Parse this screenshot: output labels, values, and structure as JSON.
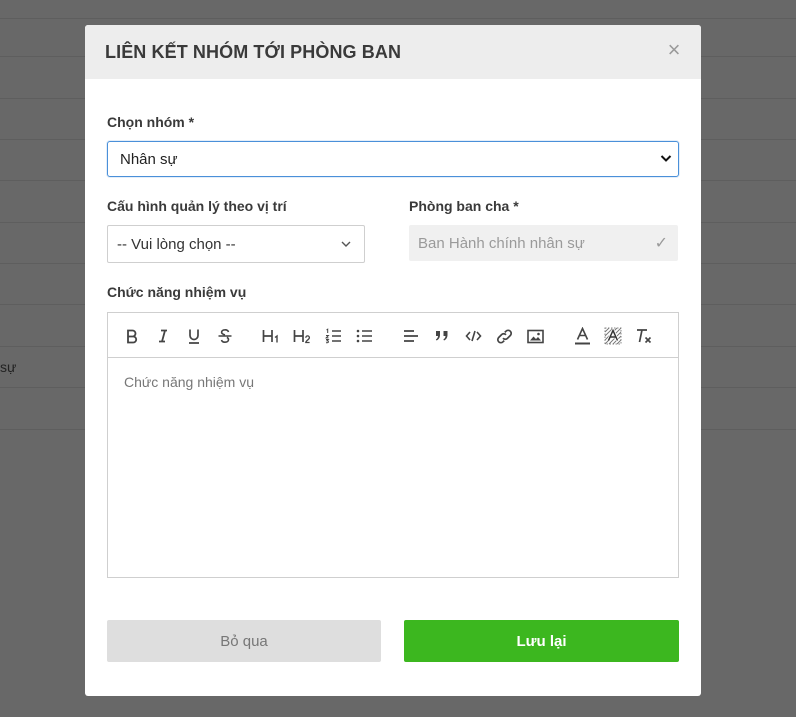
{
  "background": {
    "partial_text": "sự"
  },
  "modal": {
    "title": "LIÊN KẾT NHÓM TỚI PHÒNG BAN",
    "close_icon": "×",
    "group": {
      "label": "Chọn nhóm *",
      "value": "Nhân sự"
    },
    "position_config": {
      "label": "Cấu hình quản lý theo vị trí",
      "value": "-- Vui lòng chọn --"
    },
    "parent_department": {
      "label": "Phòng ban cha *",
      "value": "Ban Hành chính nhân sự",
      "check_icon": "✓"
    },
    "duties": {
      "label": "Chức năng nhiệm vụ",
      "placeholder": "Chức năng nhiệm vụ",
      "toolbar": [
        "bold-icon",
        "italic-icon",
        "underline-icon",
        "strikethrough-icon",
        "heading1-icon",
        "heading2-icon",
        "ordered-list-icon",
        "bullet-list-icon",
        "align-left-icon",
        "blockquote-icon",
        "code-icon",
        "link-icon",
        "image-icon",
        "text-color-icon",
        "background-color-icon",
        "clear-format-icon"
      ]
    },
    "buttons": {
      "cancel": "Bỏ qua",
      "save": "Lưu lại"
    }
  },
  "colors": {
    "overlay": "#686868",
    "accent_border": "#4a90d9",
    "save_button": "#3cb71f",
    "cancel_button": "#dedede"
  }
}
